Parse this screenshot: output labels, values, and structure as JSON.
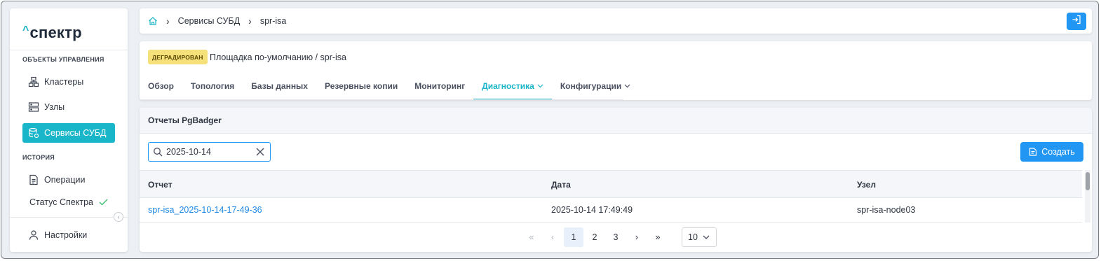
{
  "app": {
    "logo": "спектр",
    "logo_caret": "^"
  },
  "sidebar": {
    "section_objects": "ОБЪЕКТЫ УПРАВЛЕНИЯ",
    "section_history": "ИСТОРИЯ",
    "items": [
      {
        "label": "Кластеры",
        "icon": "clusters-icon"
      },
      {
        "label": "Узлы",
        "icon": "nodes-icon"
      },
      {
        "label": "Сервисы СУБД",
        "icon": "db-services-icon",
        "active": true
      },
      {
        "label": "Операции",
        "icon": "operations-icon"
      },
      {
        "label": "Статус Спектра",
        "icon": "check-icon"
      },
      {
        "label": "Настройки",
        "icon": "user-icon"
      }
    ]
  },
  "breadcrumb": {
    "home_icon": "home-icon",
    "items": [
      "Сервисы СУБД",
      "spr-isa"
    ]
  },
  "header": {
    "status_badge": "ДЕГРАДИРОВАН",
    "path": "Площадка по-умолчанию /  spr-isa",
    "tabs": [
      {
        "label": "Обзор"
      },
      {
        "label": "Топология"
      },
      {
        "label": "Базы данных"
      },
      {
        "label": "Резервные копии"
      },
      {
        "label": "Мониторинг"
      },
      {
        "label": "Диагностика",
        "active": true,
        "dropdown": true
      },
      {
        "label": "Конфигурации",
        "dropdown": true
      }
    ]
  },
  "reports": {
    "title": "Отчеты PgBadger",
    "search_value": "2025-10-14",
    "create_label": "Создать",
    "columns": [
      "Отчет",
      "Дата",
      "Узел"
    ],
    "rows": [
      {
        "report": "spr-isa_2025-10-14-17-49-36",
        "date": "2025-10-14 17:49:49",
        "node": "spr-isa-node03"
      }
    ]
  },
  "pagination": {
    "first": "«",
    "prev": "‹",
    "pages": [
      "1",
      "2",
      "3"
    ],
    "current": "1",
    "next": "›",
    "last": "»",
    "page_size": "10"
  },
  "colors": {
    "accent": "#19b5c9",
    "primary": "#2196f3",
    "badge": "#f6e07a",
    "link": "#1e88e5"
  }
}
